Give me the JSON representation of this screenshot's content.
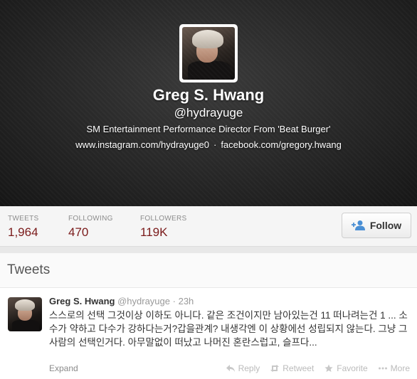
{
  "profile": {
    "name": "Greg S. Hwang",
    "handle": "@hydrayuge",
    "bio": "SM Entertainment Performance Director From 'Beat Burger'",
    "link_instagram": "www.instagram.com/hydrayuge0",
    "separator": "·",
    "link_facebook": "facebook.com/gregory.hwang"
  },
  "stats": {
    "tweets_label": "TWEETS",
    "tweets_value": "1,964",
    "following_label": "FOLLOWING",
    "following_value": "470",
    "followers_label": "FOLLOWERS",
    "followers_value": "119K"
  },
  "follow_button": {
    "label": "Follow",
    "icon": "add-person-icon"
  },
  "tweets_section": {
    "title": "Tweets"
  },
  "tweet": {
    "name": "Greg S. Hwang",
    "handle": "@hydrayuge",
    "dot": "·",
    "time": "23h",
    "text": "스스로의 선택 그것이상 이하도 아니다. 같은 조건이지만 남아있는건 11 떠나려는건 1 ... 소수가 약하고 다수가 강하다는거?갑을관계? 내생각엔 이 상황에선 성립되지 않는다. 그냥 그사람의 선택인거다. 아무말없이 떠났고 나머진 혼란스럽고, 슬프다...",
    "expand": "Expand",
    "actions": {
      "reply": "Reply",
      "retweet": "Retweet",
      "favorite": "Favorite",
      "more": "More"
    }
  },
  "colors": {
    "stat_value": "#7a1a1a",
    "header_bg": "#262626",
    "action_text": "#bbbbbb"
  }
}
